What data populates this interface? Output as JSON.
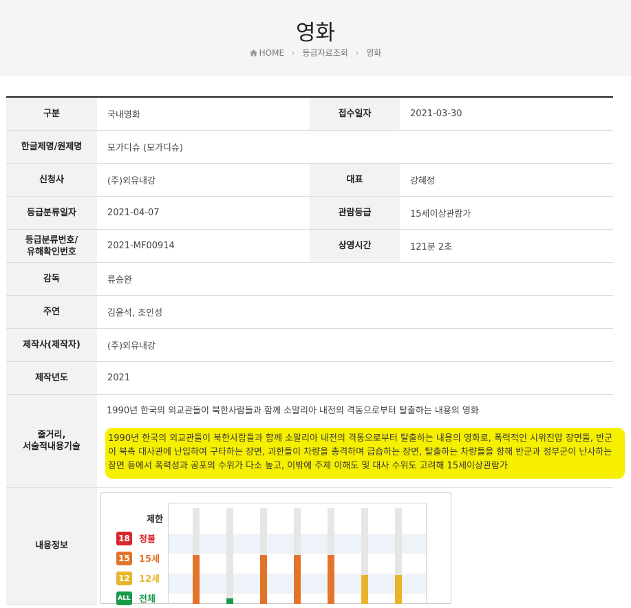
{
  "page": {
    "title": "영화",
    "breadcrumb": [
      "HOME",
      "등급자료조회",
      "영화"
    ]
  },
  "rows": [
    {
      "label": "구분",
      "value": "국내영화",
      "label2": "접수일자",
      "value2": "2021-03-30"
    },
    {
      "label": "한글제명/원제명",
      "value": "모가디슈 (모가디슈)"
    },
    {
      "label": "신청사",
      "value": "(주)외유내강",
      "label2": "대표",
      "value2": "강혜정"
    },
    {
      "label": "등급분류일자",
      "value": "2021-04-07",
      "label2": "관람등급",
      "value2": "15세이상관람가"
    },
    {
      "label": "등급분류번호/\n유해확인번호",
      "value": "2021-MF00914",
      "label2": "상영시간",
      "value2": "121분 2초"
    },
    {
      "label": "감독",
      "value": "류승완"
    },
    {
      "label": "주연",
      "value": "김윤석, 조인성"
    },
    {
      "label": "제작사(제작자)",
      "value": "(주)외유내강"
    },
    {
      "label": "제작년도",
      "value": "2021"
    }
  ],
  "story": {
    "label": "줄거리,\n서술적내용기술",
    "short": "1990년 한국의 외교관들이 북한사람들과 함께 소말리아 내전의 격동으로부터 탈출하는 내용의 영화",
    "long": "1990년 한국의 외교관들이 북한사람들과 함께 소말리아 내전의 격동으로부터 탈출하는 내용의 영화로, 폭력적인 시위진압 장면들, 반군이 북측 대사관에 난입하여 구타하는 장면, 괴한들이 차량을 총격하며 급습하는 장면, 탈출하는 차량들을 향해 반군과 정부군이 난사하는 장면 등에서 폭력성과 공포의 수위가 다소 높고, 이밖에 주제 이해도 및 대사 수위도 고려해 15세이상관람가"
  },
  "content_info": {
    "label": "내용정보",
    "levels": [
      {
        "badge": "",
        "label": "제한",
        "color": "#333333"
      },
      {
        "badge": "18",
        "label": "청불",
        "color": "#d8252f"
      },
      {
        "badge": "15",
        "label": "15세",
        "color": "#e2742a"
      },
      {
        "badge": "12",
        "label": "12세",
        "color": "#e9b32b"
      },
      {
        "badge": "ALL",
        "label": "전체",
        "color": "#199a4a"
      }
    ],
    "bars": [
      {
        "level": "15"
      },
      {
        "level": "ALL"
      },
      {
        "level": "15"
      },
      {
        "level": "15"
      },
      {
        "level": "15"
      },
      {
        "level": "12"
      },
      {
        "level": "12"
      }
    ]
  }
}
